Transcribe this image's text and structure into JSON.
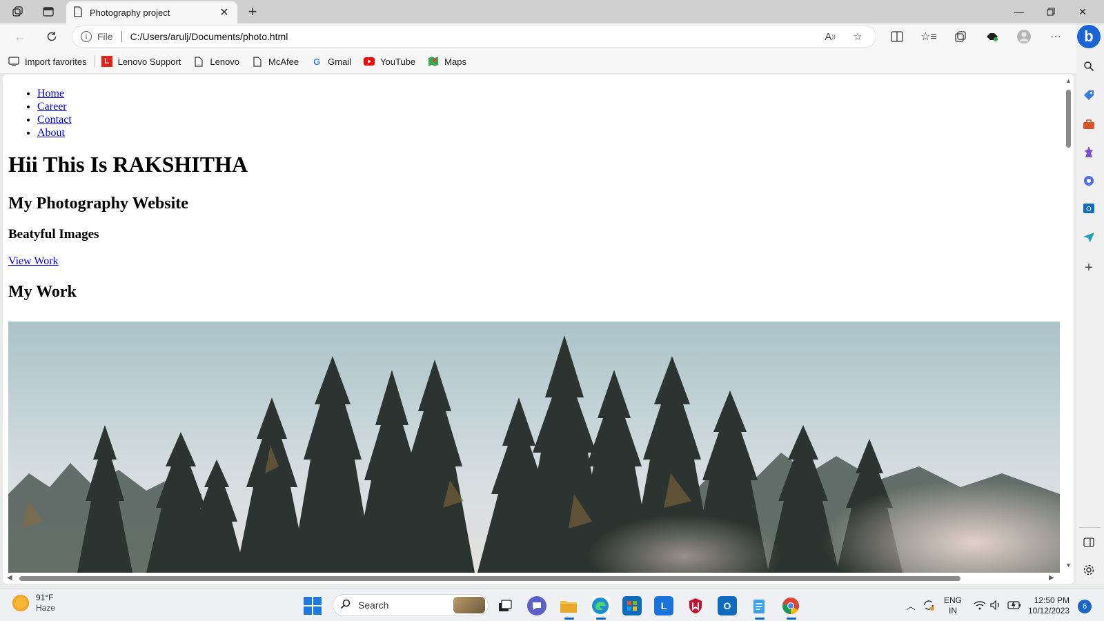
{
  "browser": {
    "tab": {
      "title": "Photography project",
      "icon": "page-icon"
    },
    "address": {
      "scheme": "File",
      "url": "C:/Users/arulj/Documents/photo.html"
    },
    "favorites": [
      {
        "label": "Import favorites",
        "icon": "import-icon"
      },
      {
        "label": "Lenovo Support",
        "icon": "lenovo-l-icon",
        "color": "#e2231a"
      },
      {
        "label": "Lenovo",
        "icon": "page-icon"
      },
      {
        "label": "McAfee",
        "icon": "page-icon"
      },
      {
        "label": "Gmail",
        "icon": "google-g-icon"
      },
      {
        "label": "YouTube",
        "icon": "youtube-icon",
        "color": "#ff0000"
      },
      {
        "label": "Maps",
        "icon": "maps-icon"
      }
    ],
    "sidebar_icons": [
      "copilot-icon",
      "search-icon",
      "shopping-icon",
      "tools-icon",
      "games-icon",
      "microsoft-365-icon",
      "outlook-icon",
      "send-icon",
      "add-icon",
      "split-pane-icon",
      "settings-icon"
    ]
  },
  "page": {
    "nav": [
      {
        "label": "Home"
      },
      {
        "label": "Career"
      },
      {
        "label": "Contact"
      },
      {
        "label": "About"
      }
    ],
    "heading": "Hii This Is RAKSHITHA",
    "subheading": "My Photography Website",
    "tagline": "Beatyful Images",
    "cta": "View Work",
    "section_title": "My Work",
    "image_subject": "pine forest with mist under pale sky"
  },
  "taskbar": {
    "weather": {
      "temp": "91°F",
      "condition": "Haze"
    },
    "search_placeholder": "Search",
    "apps": [
      "start-icon",
      "task-view-icon",
      "teams-chat-icon",
      "file-explorer-icon",
      "edge-icon",
      "store-icon",
      "lenovo-app-icon",
      "mcafee-icon",
      "outlook-app-icon",
      "notepad-icon",
      "chrome-icon"
    ],
    "tray": {
      "lang_line1": "ENG",
      "lang_line2": "IN",
      "time": "12:50 PM",
      "date": "10/12/2023",
      "notification_count": "6"
    }
  }
}
